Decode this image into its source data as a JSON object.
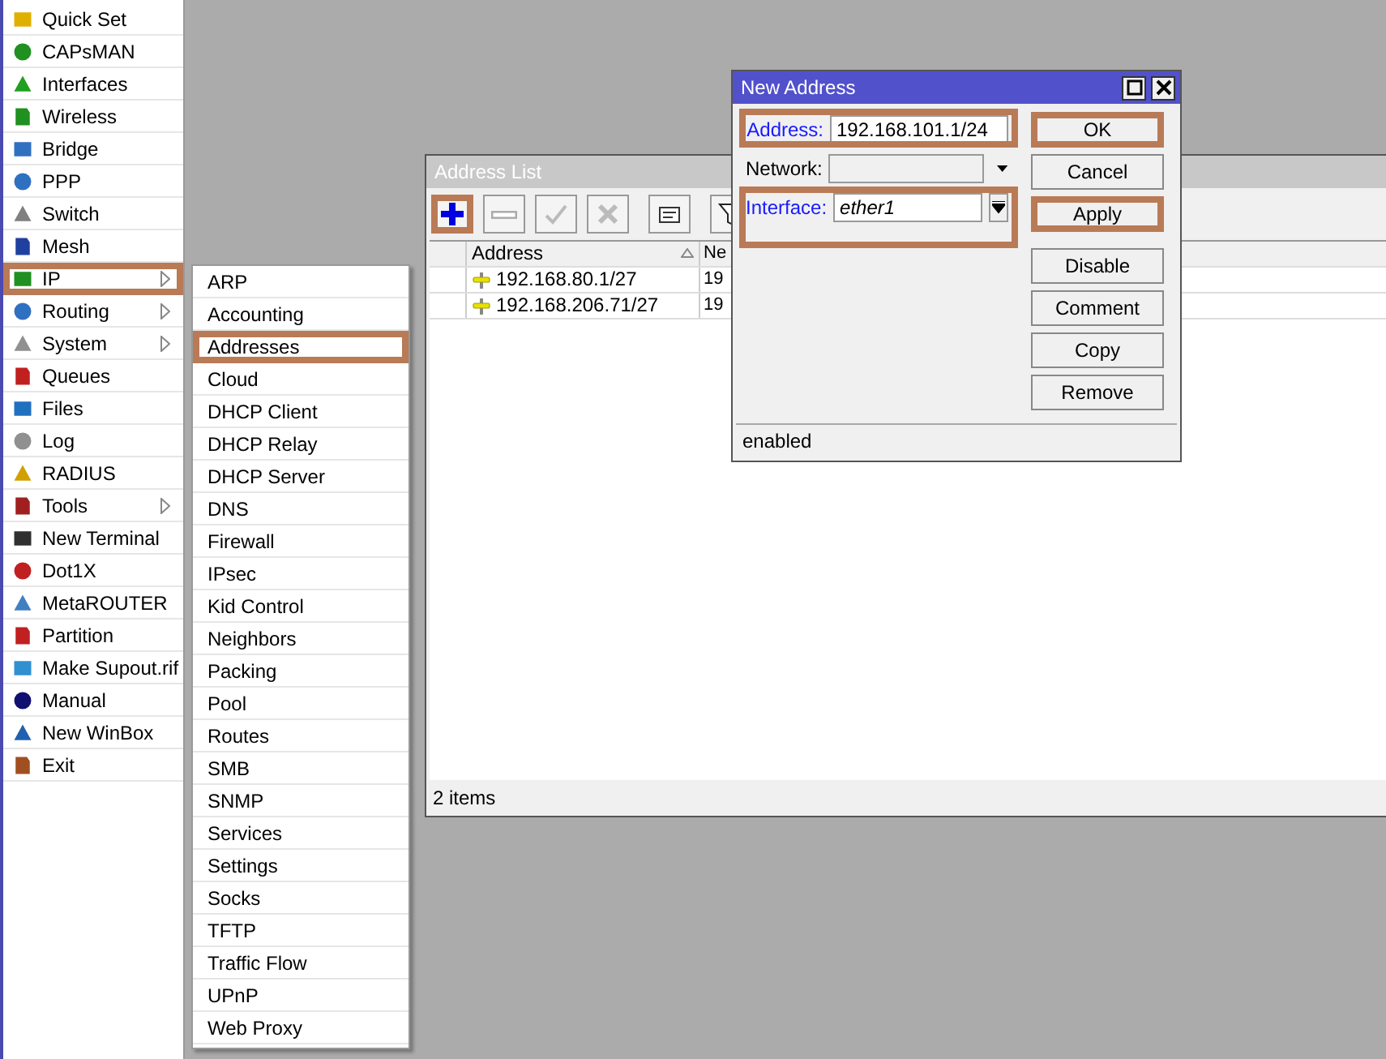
{
  "sidebar": {
    "items": [
      {
        "label": "Quick Set",
        "submenu": false,
        "highlighted": false
      },
      {
        "label": "CAPsMAN",
        "submenu": false,
        "highlighted": false
      },
      {
        "label": "Interfaces",
        "submenu": false,
        "highlighted": false
      },
      {
        "label": "Wireless",
        "submenu": false,
        "highlighted": false
      },
      {
        "label": "Bridge",
        "submenu": false,
        "highlighted": false
      },
      {
        "label": "PPP",
        "submenu": false,
        "highlighted": false
      },
      {
        "label": "Switch",
        "submenu": false,
        "highlighted": false
      },
      {
        "label": "Mesh",
        "submenu": false,
        "highlighted": false
      },
      {
        "label": "IP",
        "submenu": true,
        "highlighted": true
      },
      {
        "label": "Routing",
        "submenu": true,
        "highlighted": false
      },
      {
        "label": "System",
        "submenu": true,
        "highlighted": false
      },
      {
        "label": "Queues",
        "submenu": false,
        "highlighted": false
      },
      {
        "label": "Files",
        "submenu": false,
        "highlighted": false
      },
      {
        "label": "Log",
        "submenu": false,
        "highlighted": false
      },
      {
        "label": "RADIUS",
        "submenu": false,
        "highlighted": false
      },
      {
        "label": "Tools",
        "submenu": true,
        "highlighted": false
      },
      {
        "label": "New Terminal",
        "submenu": false,
        "highlighted": false
      },
      {
        "label": "Dot1X",
        "submenu": false,
        "highlighted": false
      },
      {
        "label": "MetaROUTER",
        "submenu": false,
        "highlighted": false
      },
      {
        "label": "Partition",
        "submenu": false,
        "highlighted": false
      },
      {
        "label": "Make Supout.rif",
        "submenu": false,
        "highlighted": false
      },
      {
        "label": "Manual",
        "submenu": false,
        "highlighted": false
      },
      {
        "label": "New WinBox",
        "submenu": false,
        "highlighted": false
      },
      {
        "label": "Exit",
        "submenu": false,
        "highlighted": false
      }
    ]
  },
  "submenu": {
    "items": [
      {
        "label": "ARP",
        "highlighted": false
      },
      {
        "label": "Accounting",
        "highlighted": false
      },
      {
        "label": "Addresses",
        "highlighted": true
      },
      {
        "label": "Cloud",
        "highlighted": false
      },
      {
        "label": "DHCP Client",
        "highlighted": false
      },
      {
        "label": "DHCP Relay",
        "highlighted": false
      },
      {
        "label": "DHCP Server",
        "highlighted": false
      },
      {
        "label": "DNS",
        "highlighted": false
      },
      {
        "label": "Firewall",
        "highlighted": false
      },
      {
        "label": "IPsec",
        "highlighted": false
      },
      {
        "label": "Kid Control",
        "highlighted": false
      },
      {
        "label": "Neighbors",
        "highlighted": false
      },
      {
        "label": "Packing",
        "highlighted": false
      },
      {
        "label": "Pool",
        "highlighted": false
      },
      {
        "label": "Routes",
        "highlighted": false
      },
      {
        "label": "SMB",
        "highlighted": false
      },
      {
        "label": "SNMP",
        "highlighted": false
      },
      {
        "label": "Services",
        "highlighted": false
      },
      {
        "label": "Settings",
        "highlighted": false
      },
      {
        "label": "Socks",
        "highlighted": false
      },
      {
        "label": "TFTP",
        "highlighted": false
      },
      {
        "label": "Traffic Flow",
        "highlighted": false
      },
      {
        "label": "UPnP",
        "highlighted": false
      },
      {
        "label": "Web Proxy",
        "highlighted": false
      }
    ]
  },
  "address_list": {
    "title": "Address List",
    "toolbar": [
      {
        "kind": "add",
        "highlighted": true,
        "disabled": false
      },
      {
        "kind": "remove",
        "highlighted": false,
        "disabled": true
      },
      {
        "kind": "enable",
        "highlighted": false,
        "disabled": true
      },
      {
        "kind": "disable",
        "highlighted": false,
        "disabled": true
      },
      {
        "kind": "comment",
        "highlighted": false,
        "disabled": false
      },
      {
        "kind": "filter",
        "highlighted": false,
        "disabled": false
      }
    ],
    "columns": [
      "Address",
      "Ne"
    ],
    "rows": [
      [
        "192.168.80.1/27",
        "19"
      ],
      [
        "192.168.206.71/27",
        "19"
      ]
    ],
    "status_bar": "2 items"
  },
  "dialog": {
    "title": "New Address",
    "fields": [
      {
        "kind": "text",
        "label": "Address:",
        "value": "192.168.101.1/24",
        "required": true,
        "highlighted": true
      },
      {
        "kind": "combo",
        "label": "Network:",
        "required": false,
        "highlighted": false
      },
      {
        "kind": "select",
        "label": "Interface:",
        "value": "ether1",
        "required": true,
        "highlighted": true
      }
    ],
    "buttons": [
      {
        "label": "OK",
        "highlighted": true
      },
      {
        "label": "Cancel",
        "highlighted": false
      },
      {
        "label": "Apply",
        "highlighted": true
      },
      {
        "label": "Disable",
        "highlighted": false
      },
      {
        "label": "Comment",
        "highlighted": false
      },
      {
        "label": "Copy",
        "highlighted": false
      },
      {
        "label": "Remove",
        "highlighted": false
      }
    ],
    "status": "enabled"
  }
}
